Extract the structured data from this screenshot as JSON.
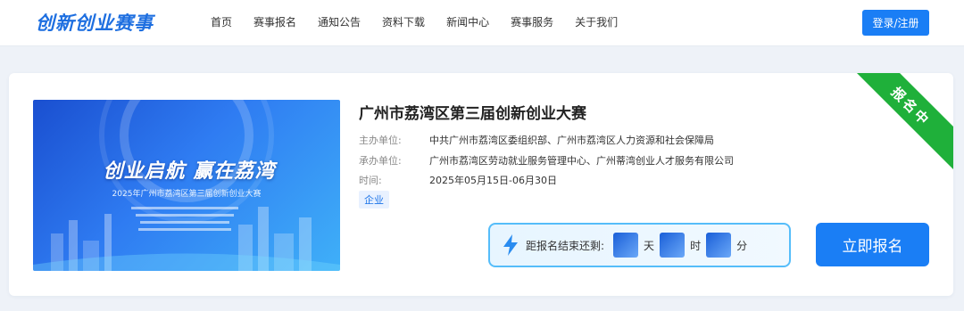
{
  "header": {
    "logo": "创新创业赛事",
    "nav": [
      "首页",
      "赛事报名",
      "通知公告",
      "资料下载",
      "新闻中心",
      "赛事服务",
      "关于我们"
    ],
    "login_label": "登录/注册"
  },
  "card": {
    "banner_title": "创业启航 赢在荔湾",
    "banner_subtitle": "2025年广州市荔湾区第三届创新创业大赛",
    "title": "广州市荔湾区第三届创新创业大赛",
    "host_label": "主办单位:",
    "host_value": "中共广州市荔湾区委组织部、广州市荔湾区人力资源和社会保障局",
    "organizer_label": "承办单位:",
    "organizer_value": "广州市荔湾区劳动就业服务管理中心、广州蒂湾创业人才服务有限公司",
    "time_label": "时间:",
    "time_value": "2025年05月15日-06月30日",
    "tag": "企业",
    "status_ribbon": "报名中",
    "countdown": {
      "label": "距报名结束还剩:",
      "units": [
        "天",
        "时",
        "分"
      ],
      "icon": "lightning-icon"
    },
    "apply_label": "立即报名"
  },
  "colors": {
    "accent": "#1a7ef5",
    "ribbon": "#1fb03a"
  }
}
